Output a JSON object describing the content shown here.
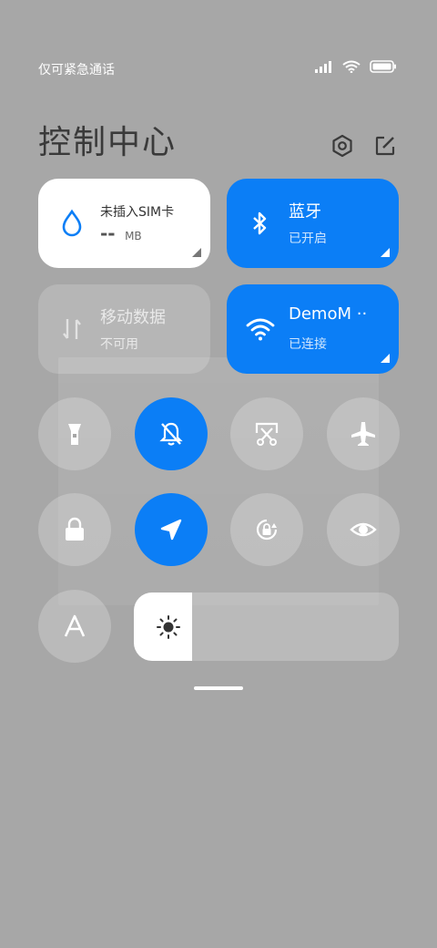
{
  "status_bar": {
    "carrier_text": "仅可紧急通话"
  },
  "header": {
    "title": "控制中心"
  },
  "tiles": {
    "sim": {
      "title": "未插入SIM卡",
      "value": "--",
      "unit": "MB"
    },
    "bluetooth": {
      "title": "蓝牙",
      "status": "已开启"
    },
    "mobile_data": {
      "title": "移动数据",
      "status": "不可用"
    },
    "wifi": {
      "title": "DemoM ··",
      "status": "已连接"
    }
  },
  "toggles": [
    {
      "name": "flashlight",
      "active": false
    },
    {
      "name": "mute",
      "active": true
    },
    {
      "name": "screenshot",
      "active": false
    },
    {
      "name": "airplane-mode",
      "active": false
    },
    {
      "name": "lock-screen",
      "active": false
    },
    {
      "name": "location",
      "active": true
    },
    {
      "name": "auto-rotate-lock",
      "active": false
    },
    {
      "name": "eye-comfort",
      "active": false
    },
    {
      "name": "reading-mode",
      "active": false
    }
  ],
  "brightness": {
    "level_fraction": 0.22
  },
  "colors": {
    "accent": "#0b7ef6",
    "background": "#a7a7a7"
  }
}
